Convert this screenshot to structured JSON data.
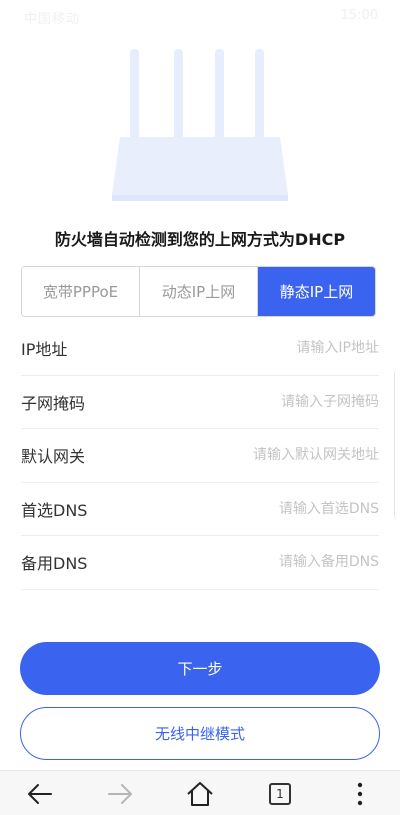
{
  "status_bar": {
    "left_text": "中国移动",
    "right_text": "15:00"
  },
  "title": "防火墙自动检测到您的上网方式为DHCP",
  "mode_tabs": [
    {
      "label": "宽带PPPoE",
      "active": false
    },
    {
      "label": "动态IP上网",
      "active": false
    },
    {
      "label": "静态IP上网",
      "active": true
    }
  ],
  "form": {
    "ip": {
      "label": "IP地址",
      "placeholder": "请输入IP地址",
      "value": ""
    },
    "mask": {
      "label": "子网掩码",
      "placeholder": "请输入子网掩码",
      "value": ""
    },
    "gateway": {
      "label": "默认网关",
      "placeholder": "请输入默认网关地址",
      "value": ""
    },
    "dns1": {
      "label": "首选DNS",
      "placeholder": "请输入首选DNS",
      "value": ""
    },
    "dns2": {
      "label": "备用DNS",
      "placeholder": "请输入备用DNS",
      "value": ""
    }
  },
  "buttons": {
    "next": "下一步",
    "repeater": "无线中继模式"
  },
  "browser_bar": {
    "tab_count": "1",
    "icons": [
      "back-arrow-icon",
      "forward-arrow-icon",
      "home-icon",
      "tabs-icon",
      "more-icon"
    ]
  },
  "colors": {
    "accent": "#3a63f0",
    "router": "#e6edfd",
    "placeholder": "#c4c4c4"
  }
}
